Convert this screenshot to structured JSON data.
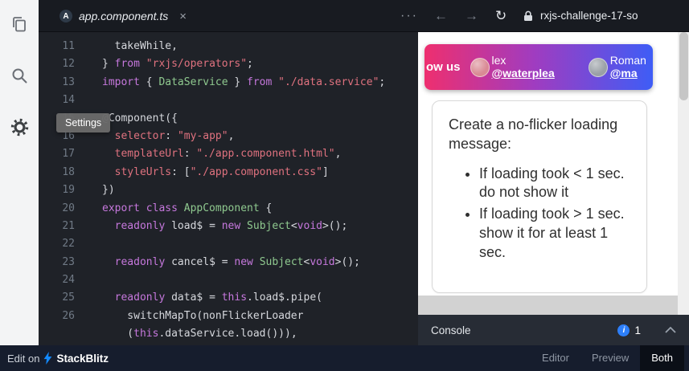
{
  "activity_bar": {
    "tooltip": "Settings",
    "icons": [
      {
        "name": "files-icon"
      },
      {
        "name": "search-icon"
      },
      {
        "name": "settings-icon"
      }
    ]
  },
  "top_bar": {
    "tab_label": "app.component.ts",
    "tab_icon_letter": "A",
    "close_label": "×",
    "more_label": "···",
    "back_label": "←",
    "forward_label": "→",
    "refresh_label": "↻",
    "url": "rxjs-challenge-17-so"
  },
  "editor": {
    "lines": [
      {
        "num": "11",
        "tokens": [
          {
            "t": "  takeWhile,",
            "c": "plain"
          }
        ]
      },
      {
        "num": "12",
        "tokens": [
          {
            "t": "} ",
            "c": "plain"
          },
          {
            "t": "from",
            "c": "kw"
          },
          {
            "t": " ",
            "c": "plain"
          },
          {
            "t": "\"rxjs/operators\"",
            "c": "str"
          },
          {
            "t": ";",
            "c": "plain"
          }
        ]
      },
      {
        "num": "13",
        "tokens": [
          {
            "t": "import",
            "c": "kw"
          },
          {
            "t": " { ",
            "c": "plain"
          },
          {
            "t": "DataService",
            "c": "type"
          },
          {
            "t": " } ",
            "c": "plain"
          },
          {
            "t": "from",
            "c": "kw"
          },
          {
            "t": " ",
            "c": "plain"
          },
          {
            "t": "\"./data.service\"",
            "c": "str"
          },
          {
            "t": ";",
            "c": "plain"
          }
        ]
      },
      {
        "num": "14",
        "tokens": []
      },
      {
        "num": "15",
        "tokens": [
          {
            "t": "@Component({",
            "c": "plain"
          }
        ]
      },
      {
        "num": "16",
        "tokens": [
          {
            "t": "  ",
            "c": "plain"
          },
          {
            "t": "selector",
            "c": "prop"
          },
          {
            "t": ": ",
            "c": "plain"
          },
          {
            "t": "\"my-app\"",
            "c": "str"
          },
          {
            "t": ",",
            "c": "plain"
          }
        ]
      },
      {
        "num": "17",
        "tokens": [
          {
            "t": "  ",
            "c": "plain"
          },
          {
            "t": "templateUrl",
            "c": "prop"
          },
          {
            "t": ": ",
            "c": "plain"
          },
          {
            "t": "\"./app.component.html\"",
            "c": "str"
          },
          {
            "t": ",",
            "c": "plain"
          }
        ]
      },
      {
        "num": "18",
        "tokens": [
          {
            "t": "  ",
            "c": "plain"
          },
          {
            "t": "styleUrls",
            "c": "prop"
          },
          {
            "t": ": [",
            "c": "plain"
          },
          {
            "t": "\"./app.component.css\"",
            "c": "str"
          },
          {
            "t": "]",
            "c": "plain"
          }
        ]
      },
      {
        "num": "19",
        "tokens": [
          {
            "t": "})",
            "c": "plain"
          }
        ]
      },
      {
        "num": "20",
        "tokens": [
          {
            "t": "export class",
            "c": "kw"
          },
          {
            "t": " ",
            "c": "plain"
          },
          {
            "t": "AppComponent",
            "c": "type"
          },
          {
            "t": " {",
            "c": "plain"
          }
        ]
      },
      {
        "num": "21",
        "tokens": [
          {
            "t": "  ",
            "c": "plain"
          },
          {
            "t": "readonly",
            "c": "kw"
          },
          {
            "t": " load$ = ",
            "c": "plain"
          },
          {
            "t": "new",
            "c": "kw"
          },
          {
            "t": " ",
            "c": "plain"
          },
          {
            "t": "Subject",
            "c": "type"
          },
          {
            "t": "<",
            "c": "plain"
          },
          {
            "t": "void",
            "c": "kw"
          },
          {
            "t": ">();",
            "c": "plain"
          }
        ]
      },
      {
        "num": "22",
        "tokens": []
      },
      {
        "num": "23",
        "tokens": [
          {
            "t": "  ",
            "c": "plain"
          },
          {
            "t": "readonly",
            "c": "kw"
          },
          {
            "t": " cancel$ = ",
            "c": "plain"
          },
          {
            "t": "new",
            "c": "kw"
          },
          {
            "t": " ",
            "c": "plain"
          },
          {
            "t": "Subject",
            "c": "type"
          },
          {
            "t": "<",
            "c": "plain"
          },
          {
            "t": "void",
            "c": "kw"
          },
          {
            "t": ">();",
            "c": "plain"
          }
        ]
      },
      {
        "num": "24",
        "tokens": []
      },
      {
        "num": "25",
        "tokens": [
          {
            "t": "  ",
            "c": "plain"
          },
          {
            "t": "readonly",
            "c": "kw"
          },
          {
            "t": " data$ = ",
            "c": "plain"
          },
          {
            "t": "this",
            "c": "kw"
          },
          {
            "t": ".load$.pipe(",
            "c": "plain"
          }
        ]
      },
      {
        "num": "26",
        "tokens": [
          {
            "t": "    switchMapTo(nonFlickerLoader",
            "c": "plain"
          }
        ]
      },
      {
        "num": "",
        "tokens": [
          {
            "t": "    (",
            "c": "plain"
          },
          {
            "t": "this",
            "c": "kw"
          },
          {
            "t": ".dataService.load())),",
            "c": "plain"
          }
        ]
      }
    ]
  },
  "preview": {
    "banner": {
      "text": "ow us",
      "people": [
        {
          "name": "lex",
          "handle": "@waterplea",
          "avatar_color": "#d98a94"
        },
        {
          "name": "Roman",
          "handle": "@ma",
          "avatar_color": "#9aa0a6"
        }
      ]
    },
    "card": {
      "title": "Create a no-flicker loading message:",
      "bullets": [
        "If loading took < 1 sec. do not show it",
        "If loading took > 1 sec. show it for at least 1 sec."
      ]
    }
  },
  "console": {
    "label": "Console",
    "info_icon": "i",
    "count": "1"
  },
  "footer": {
    "edit_on": "Edit on",
    "brand": "StackBlitz",
    "views": [
      "Editor",
      "Preview",
      "Both"
    ],
    "active_view": "Both"
  },
  "colors": {
    "banner_gradient": [
      "#ee2f6f",
      "#a03cc0",
      "#3e5df6"
    ],
    "console_badge": "#2d7ff9",
    "stackblitz_blue": "#1389fd",
    "editor_bg": "#1f2228"
  }
}
